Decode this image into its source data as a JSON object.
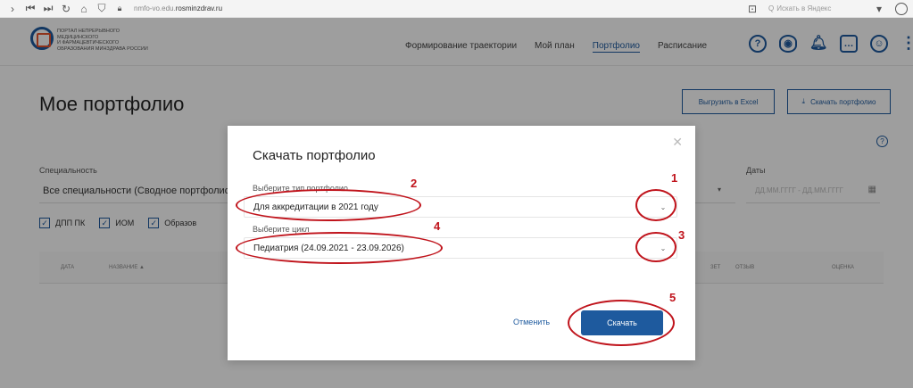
{
  "browser": {
    "url_prefix": "nmfo-vo.edu.",
    "url_domain": "rosminzdrav.ru",
    "search_placeholder": "Искать в Яндекс",
    "icons": [
      "forward-icon",
      "home-icon",
      "reload-icon",
      "home-icon",
      "shield-icon",
      "lock-icon",
      "bookmark-icon",
      "yandex-search-icon",
      "profile-icon"
    ]
  },
  "header": {
    "logo_lines": [
      "Портал непрерывного",
      "медицинского",
      "и фармацевтического",
      "образования Минздрава России"
    ],
    "nav": [
      "Формирование траектории",
      "Мой план",
      "Портфолио",
      "Расписание"
    ],
    "active_nav": "Портфолио",
    "icons": [
      "help-icon",
      "eye-icon",
      "bell-icon",
      "chat-icon",
      "user-icon",
      "more-icon"
    ]
  },
  "page": {
    "title": "Мое портфолио",
    "excel_button": "Выгрузить в Excel",
    "download_button": "Скачать портфолио",
    "specialty_label": "Специальность",
    "specialty_value": "Все специальности (Сводное портфолио",
    "dates_label": "Даты",
    "dates_placeholder": "ДД.ММ.ГГГГ - ДД.ММ.ГГГГ",
    "checkboxes": [
      "ДПП ПК",
      "ИОМ",
      "Образов"
    ],
    "table_columns": [
      "Дата",
      "Название ▲",
      "ЗЕТ",
      "Отзыв",
      "Оценка"
    ]
  },
  "modal": {
    "title": "Скачать портфолио",
    "type_label": "Выберите тип портфолио",
    "type_value": "Для аккредитации в 2021 году",
    "cycle_label": "Выберите цикл",
    "cycle_value": "Педиатрия (24.09.2021 - 23.09.2026)",
    "cancel_label": "Отменить",
    "download_label": "Скачать"
  },
  "annotations": {
    "numbers": [
      "1",
      "2",
      "3",
      "4",
      "5"
    ],
    "color": "#c0141c"
  },
  "colors": {
    "brand_blue": "#1e5a9e",
    "logo_accent": "#e5532d"
  }
}
